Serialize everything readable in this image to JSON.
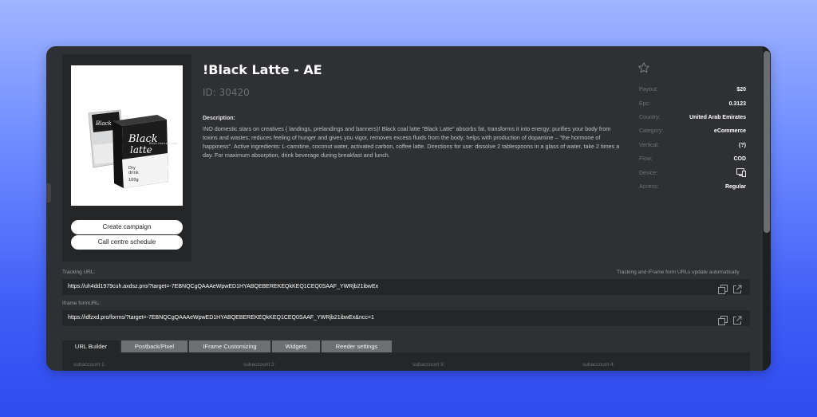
{
  "offer": {
    "title": "!Black Latte - AE",
    "id_text": "ID: 30420",
    "description_label": "Description:",
    "description": "!NO domestic stars on creatives ( landings, prelandings and banners)! Black coal latte \"Black Latte\" absorbs fat, transforms it into energy; purifies your body from toxins and wastes; reduces feeling of hunger and gives you vigor, removes excess fluids from the body; helps with production of dopamine – \"the hormone of happiness\". Active ingredients: L-carnitine, coconut water, activated carbon, coffee latte. Directions for use: dissolve 2 tablespoons in a glass of water, take 2 times a day. For maximum absorption, drink beverage during breakfast and lunch.",
    "product_image_icon": "black-latte-product-image",
    "pack_text": "Black latte",
    "box_text": "Black charcoal latte"
  },
  "buttons": {
    "create_campaign": "Create campaign",
    "call_centre": "Call centre schedule"
  },
  "props": [
    {
      "key": "payout",
      "label": "Payout:",
      "value": "$20"
    },
    {
      "key": "epc",
      "label": "Epc:",
      "value": "0.3123"
    },
    {
      "key": "country",
      "label": "Country:",
      "value": "United Arab Emirates"
    },
    {
      "key": "category",
      "label": "Category:",
      "value": "eCommerce"
    },
    {
      "key": "vertical",
      "label": "Vertical:",
      "value": "(?)"
    },
    {
      "key": "flow",
      "label": "Flow:",
      "value": "COD"
    },
    {
      "key": "device",
      "label": "Device:",
      "value": ""
    },
    {
      "key": "access",
      "label": "Access:",
      "value": "Regular"
    }
  ],
  "tracking": {
    "label": "Tracking URL:",
    "note": "Tracking and iFrame form URLs update automatically",
    "url": "https://uh4dd1979cuh.axdsz.pro/?target=-7EBNQCgQAAAeWpwED1HYABQEBEREKEQkKEQ1CEQ0SAAF_YWRjb21ibwEx"
  },
  "iframe": {
    "label": "Iframe formURL:",
    "url": "https://idfzxd.pro/forms/?target=-7EBNQCgQAAAeWpwED1HYABQEBEREKEQkKEQ1CEQ0SAAF_YWRjb21ibwEx&ncc=1"
  },
  "tabs": [
    "URL Builder",
    "Postback/Pixel",
    "IFrame Customizing",
    "Widgets",
    "Reeder settings"
  ],
  "builder": {
    "sub1": "subaccount 1:",
    "sub2": "subaccount 2:",
    "sub3": "subaccount 3:",
    "sub4": "subaccount 4:"
  },
  "colors": {
    "panel": "#2e3033",
    "field": "#242628",
    "tab_inactive": "#6d7073",
    "background_top": "#9fb4ff",
    "background_bottom": "#2f4cf0"
  }
}
